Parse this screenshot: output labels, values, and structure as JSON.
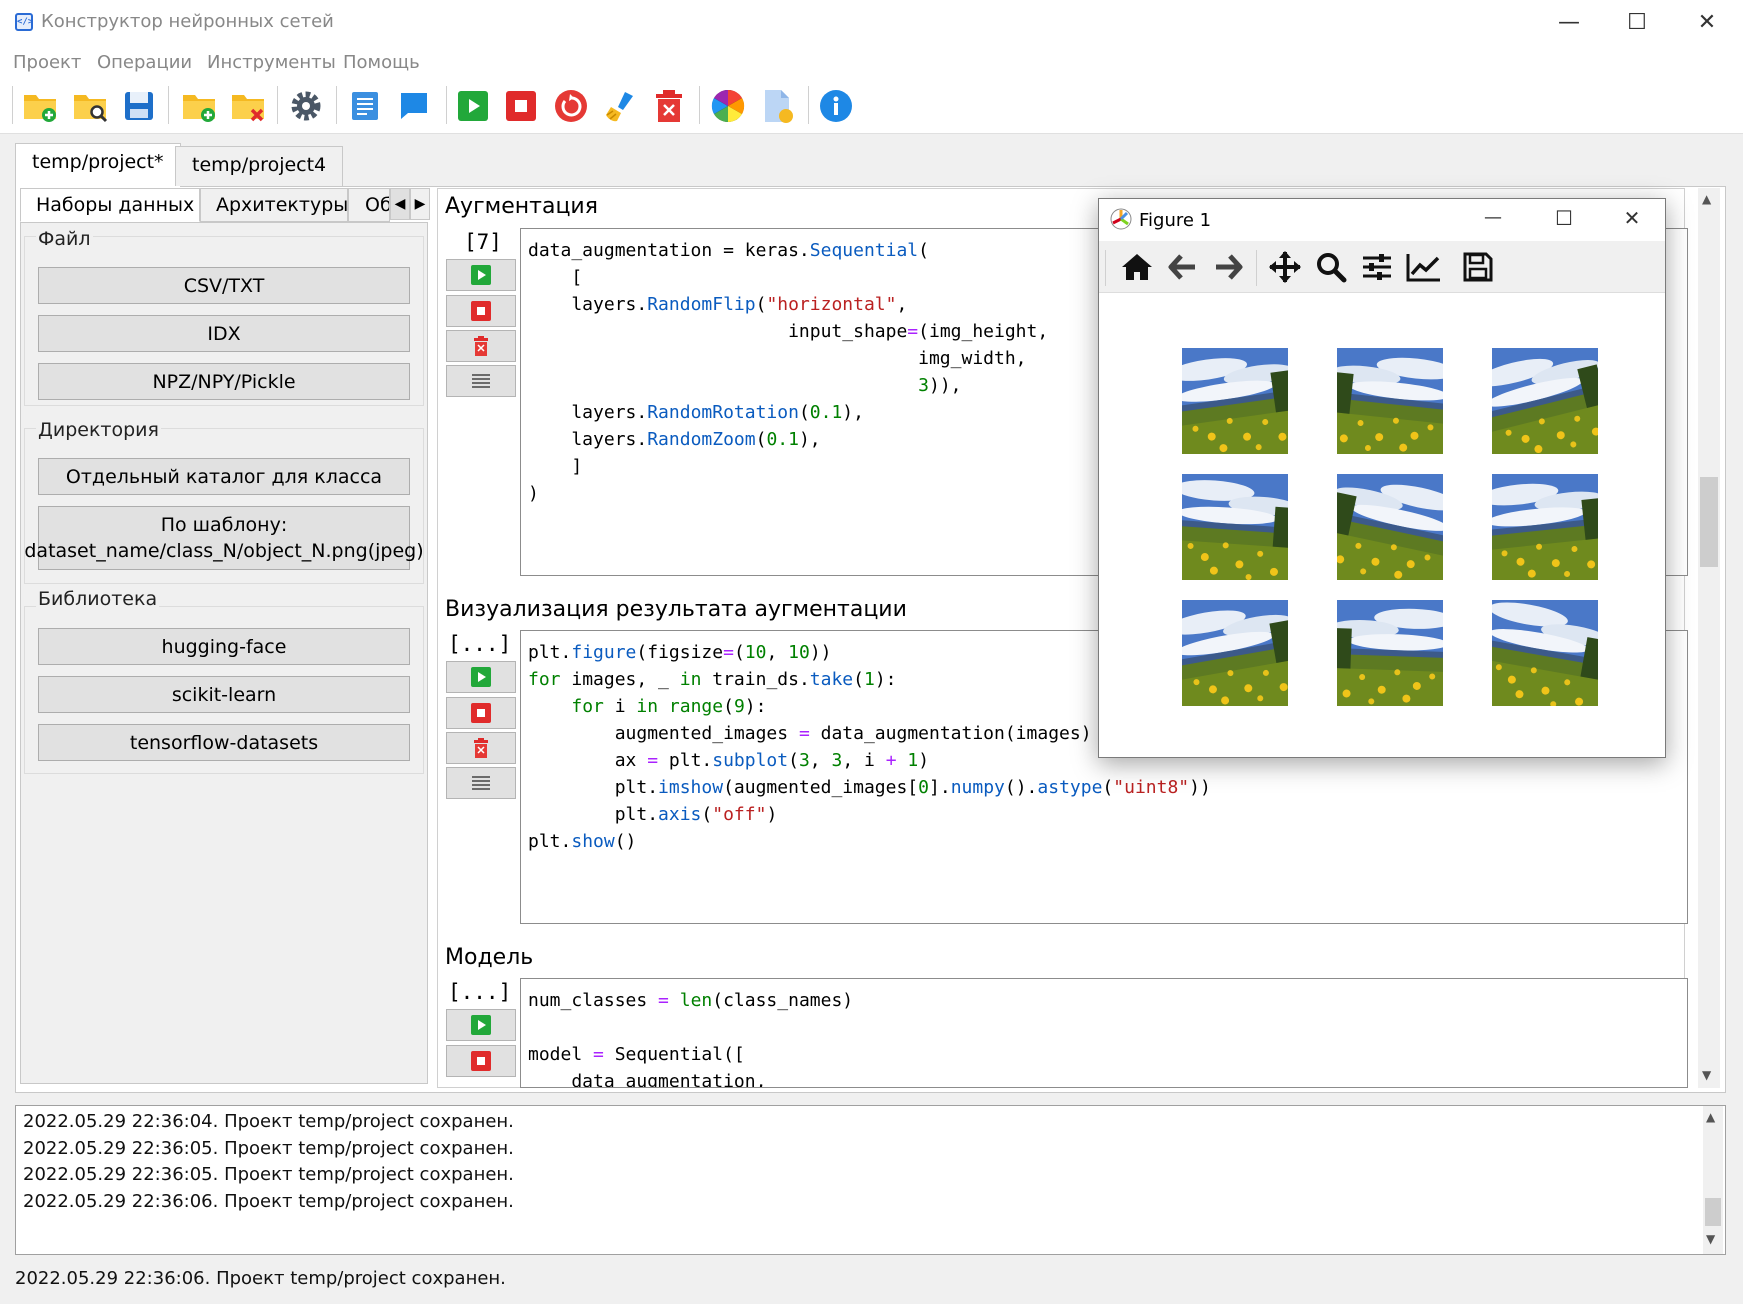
{
  "window": {
    "title": "Конструктор нейронных сетей",
    "icon": "code-window-icon"
  },
  "menu": [
    "Проект",
    "Операции",
    "Инструменты",
    "Помощь"
  ],
  "toolbar_icons": [
    "new-project-icon",
    "open-project-icon",
    "save-icon",
    "add-folder-icon",
    "remove-folder-icon",
    "settings-icon",
    "text-document-icon",
    "comment-icon",
    "run-icon",
    "stop-icon",
    "restart-icon",
    "clear-brush-icon",
    "delete-icon",
    "color-wheel-icon",
    "new-file-icon",
    "info-icon"
  ],
  "project_tabs": [
    "temp/project*",
    "temp/project4"
  ],
  "left_tabs": [
    "Наборы данных",
    "Архитектуры",
    "Об"
  ],
  "left_groups": {
    "file": {
      "label": "Файл",
      "buttons": [
        "CSV/TXT",
        "IDX",
        "NPZ/NPY/Pickle"
      ]
    },
    "directory": {
      "label": "Директория",
      "buttons": [
        "Отдельный каталог для класса",
        "По шаблону:",
        "dataset_name/class_N/object_N.png(jpeg)"
      ]
    },
    "library": {
      "label": "Библиотека",
      "buttons": [
        "hugging-face",
        "scikit-learn",
        "tensorflow-datasets"
      ]
    }
  },
  "cells": [
    {
      "title": "Аугментация",
      "count": "[7]",
      "code": [
        "data_augmentation = keras.Sequential(",
        "    [",
        "    layers.RandomFlip(\"horizontal\",",
        "                        input_shape=(img_height,",
        "                                    img_width,",
        "                                    3)),",
        "    layers.RandomRotation(0.1),",
        "    layers.RandomZoom(0.1),",
        "    ]",
        ")"
      ]
    },
    {
      "title": "Визуализация результата аугментации",
      "count": "[...]",
      "code": [
        "plt.figure(figsize=(10, 10))",
        "for images, _ in train_ds.take(1):",
        "    for i in range(9):",
        "        augmented_images = data_augmentation(images)",
        "        ax = plt.subplot(3, 3, i + 1)",
        "        plt.imshow(augmented_images[0].numpy().astype(\"uint8\"))",
        "        plt.axis(\"off\")",
        "plt.show()"
      ]
    },
    {
      "title": "Модель",
      "count": "[...]",
      "code": [
        "num_classes = len(class_names)",
        "",
        "model = Sequential([",
        "    data_augmentation,"
      ]
    }
  ],
  "figure": {
    "title": "Figure 1",
    "tools": [
      "home-icon",
      "back-arrow-icon",
      "forward-arrow-icon",
      "pan-icon",
      "zoom-icon",
      "configure-subplots-icon",
      "edit-axes-icon",
      "save-figure-icon"
    ]
  },
  "log": [
    "2022.05.29 22:36:04. Проект temp/project сохранен.",
    "2022.05.29 22:36:05. Проект temp/project сохранен.",
    "2022.05.29 22:36:05. Проект temp/project сохранен.",
    "2022.05.29 22:36:06. Проект temp/project сохранен."
  ],
  "status": "2022.05.29 22:36:06. Проект temp/project сохранен.",
  "colors": {
    "run": "#22a83a",
    "stop": "#e02b2b",
    "accent": "#1e88e5",
    "folder": "#f5b921"
  }
}
